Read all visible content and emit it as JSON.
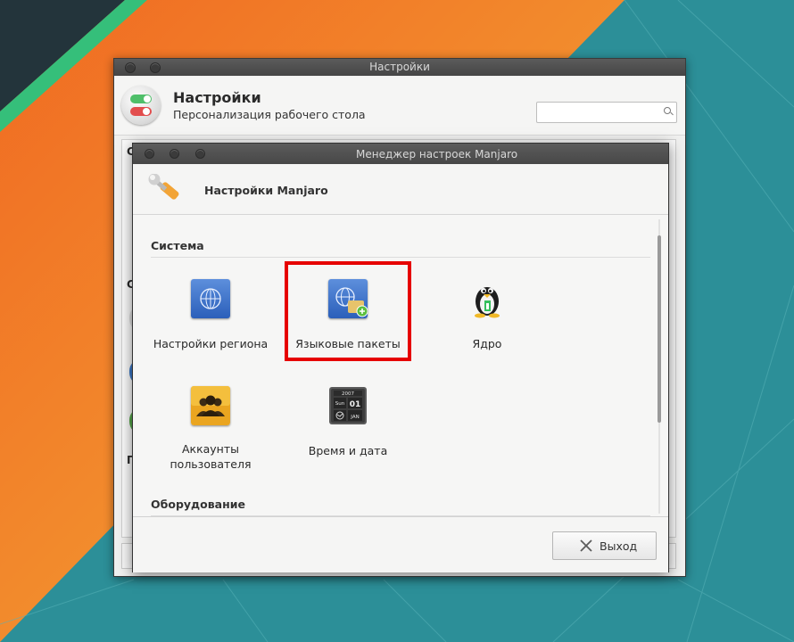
{
  "back_window": {
    "title": "Настройки",
    "heading": "Настройки",
    "subtitle": "Персонализация рабочего стола",
    "search_placeholder": ""
  },
  "front_window": {
    "title": "Менеджер настроек Manjaro",
    "heading": "Настройки Manjaro",
    "sections": [
      {
        "title": "Система",
        "items": [
          {
            "label": "Настройки региона",
            "icon": "globe-icon"
          },
          {
            "label": "Языковые пакеты",
            "icon": "language-packages-icon",
            "highlighted": true
          },
          {
            "label": "Ядро",
            "icon": "tux-penguin-icon"
          },
          {
            "label": "Аккаунты\nпользователя",
            "icon": "user-accounts-icon"
          },
          {
            "label": "Время и дата",
            "icon": "calendar-clock-icon"
          }
        ]
      },
      {
        "title": "Оборудование",
        "items": []
      }
    ],
    "calendar_icon": {
      "year": "2007",
      "day_name": "Sun",
      "day": "01",
      "month": "JAN"
    },
    "exit_label": "Выход"
  },
  "colors": {
    "highlight": "#e60000",
    "desktop_orange": "#f08a2c",
    "desktop_teal": "#2e8f9a",
    "manjaro_green": "#35bf5c"
  }
}
